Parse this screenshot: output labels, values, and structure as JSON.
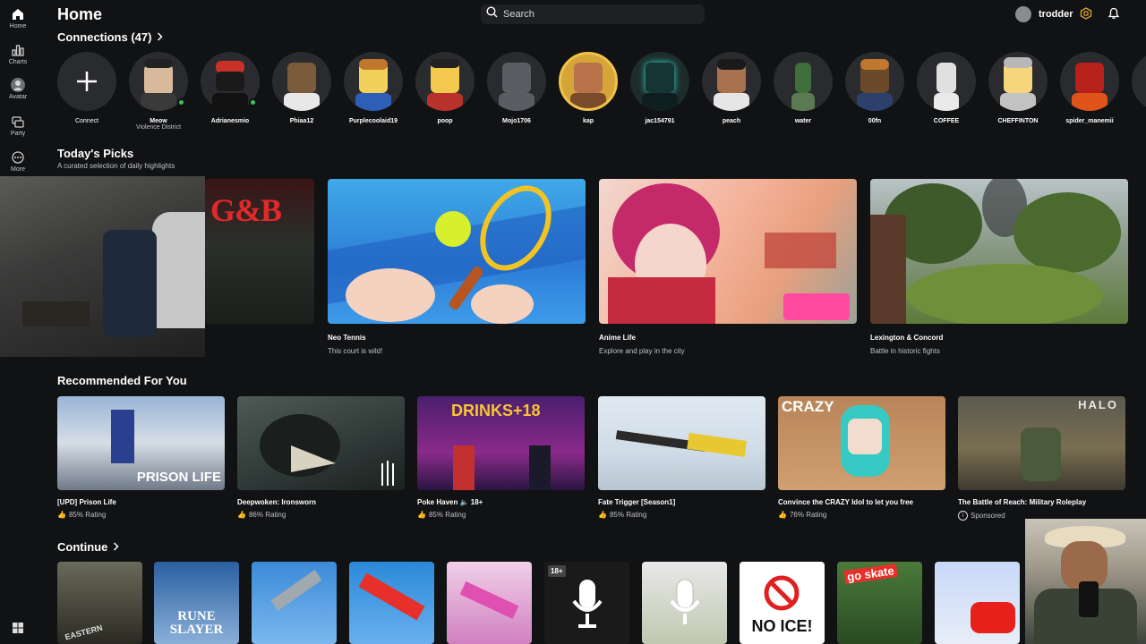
{
  "sidebar": {
    "items": [
      {
        "label": "Home",
        "icon": "home-icon"
      },
      {
        "label": "Charts",
        "icon": "charts-icon"
      },
      {
        "label": "Avatar",
        "icon": "avatar-icon"
      },
      {
        "label": "Party",
        "icon": "party-icon"
      },
      {
        "label": "More",
        "icon": "more-icon"
      }
    ]
  },
  "header": {
    "title": "Home",
    "search_placeholder": "Search",
    "username": "trodder"
  },
  "connections": {
    "title": "Connections (47)",
    "connect_label": "Connect",
    "friends": [
      {
        "name": "Meow",
        "status": "Violence District",
        "online": true
      },
      {
        "name": "Adrianesmio",
        "status": "",
        "online": true
      },
      {
        "name": "Phiaa12",
        "status": "",
        "online": false
      },
      {
        "name": "Purplecoolaid19",
        "status": "",
        "online": false
      },
      {
        "name": "poop",
        "status": "",
        "online": false
      },
      {
        "name": "Mojo1706",
        "status": "",
        "online": false
      },
      {
        "name": "kap",
        "status": "",
        "online": false
      },
      {
        "name": "jac154791",
        "status": "",
        "online": false
      },
      {
        "name": "peach",
        "status": "",
        "online": false
      },
      {
        "name": "water",
        "status": "",
        "online": false
      },
      {
        "name": "00fn",
        "status": "",
        "online": false
      },
      {
        "name": "COFFEE",
        "status": "",
        "online": false
      },
      {
        "name": "CHEFFINTON",
        "status": "",
        "online": false
      },
      {
        "name": "spider_manemii",
        "status": "",
        "online": false
      }
    ]
  },
  "picks": {
    "title": "Today's Picks",
    "subtitle": "A curated selection of daily highlights",
    "partial_thumb_text": "G&B",
    "items": [
      {
        "title": "Neo Tennis",
        "desc": "This court is wild!"
      },
      {
        "title": "Anime Life",
        "desc": "Explore and play in the city"
      },
      {
        "title": "Lexington & Concord",
        "desc": "Battle in historic fights"
      }
    ]
  },
  "recommended": {
    "title": "Recommended For You",
    "items": [
      {
        "title": "[UPD] Prison Life",
        "meta": "85% Rating",
        "thumb_text": "PRISON LIFE"
      },
      {
        "title": "Deepwoken: Ironsworn",
        "meta": "86% Rating",
        "thumb_text": ""
      },
      {
        "title": "Poke Haven 🔈 18+",
        "meta": "85% Rating",
        "thumb_text": "DRINKS+18"
      },
      {
        "title": "Fate Trigger [Season1]",
        "meta": "85% Rating",
        "thumb_text": ""
      },
      {
        "title": "Convince the CRAZY Idol to let you free",
        "meta": "76% Rating",
        "thumb_text": "CRAZY"
      },
      {
        "title": "The Battle of Reach: Military Roleplay",
        "meta": "Sponsored",
        "thumb_text": "HALO"
      }
    ]
  },
  "continue": {
    "title": "Continue",
    "items": [
      {
        "thumb_text": "EASTERN"
      },
      {
        "thumb_text": "RUNE SLAYER"
      },
      {
        "thumb_text": ""
      },
      {
        "thumb_text": ""
      },
      {
        "thumb_text": ""
      },
      {
        "thumb_text": "18+"
      },
      {
        "thumb_text": ""
      },
      {
        "thumb_text": "NO ICE!"
      },
      {
        "thumb_text": "go skate"
      },
      {
        "thumb_text": ""
      }
    ]
  }
}
